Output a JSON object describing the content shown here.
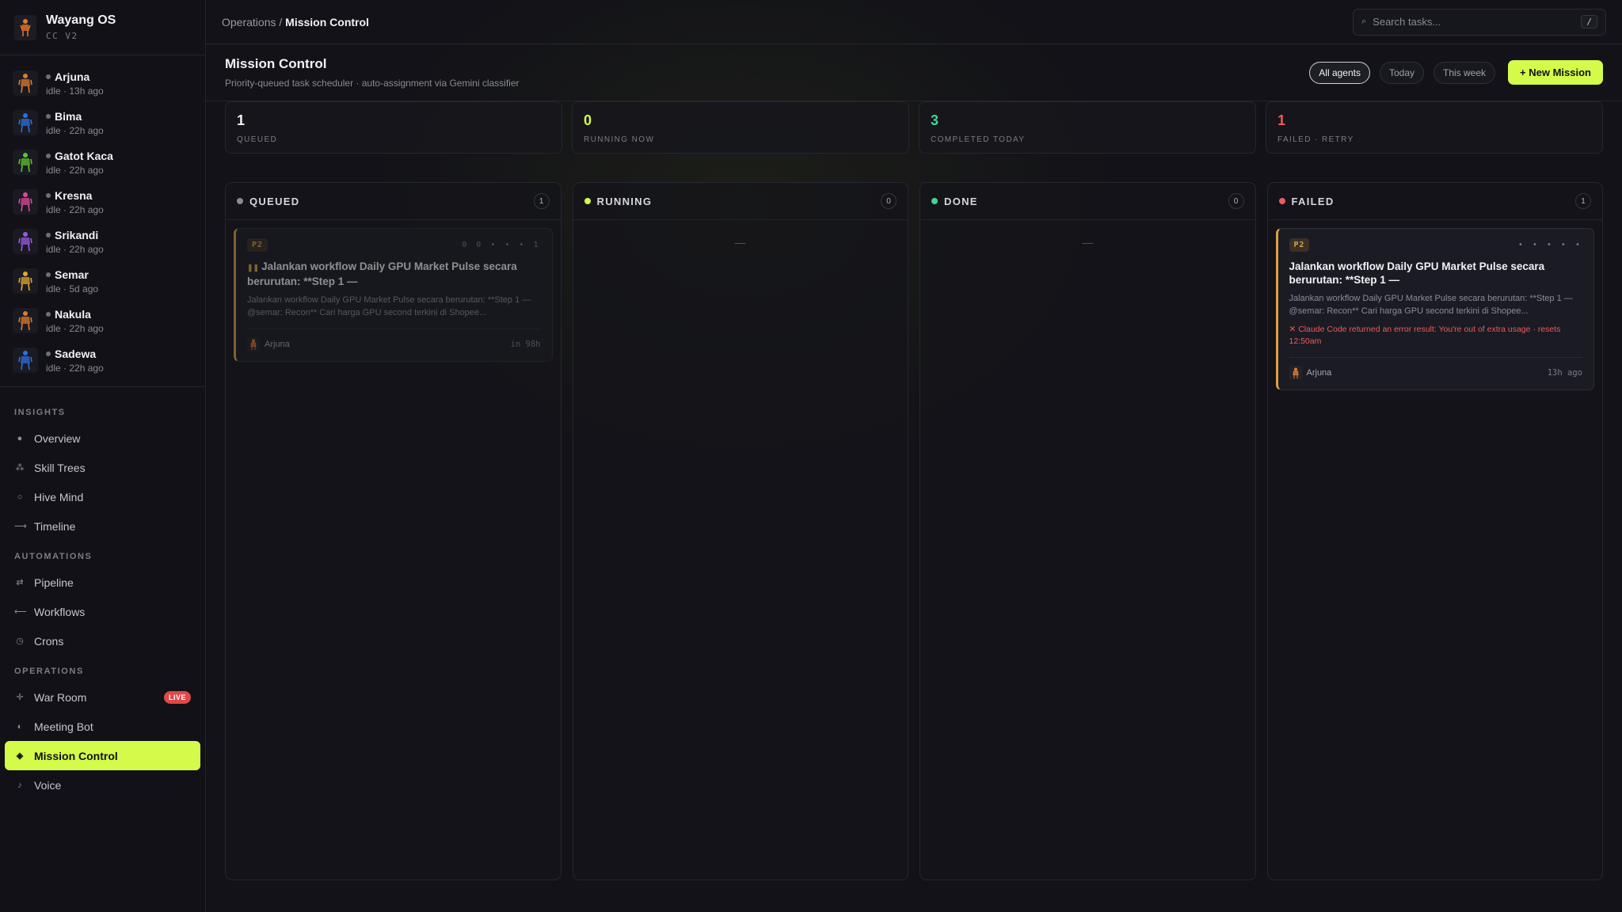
{
  "brand": {
    "name": "Wayang OS",
    "sub": "CC V2"
  },
  "agents": [
    {
      "name": "Arjuna",
      "status": "idle · 13h ago",
      "color": "#e07a2c",
      "icon": "arjuna-puppet-icon"
    },
    {
      "name": "Bima",
      "status": "idle · 22h ago",
      "color": "#2f6fe0",
      "icon": "bima-puppet-icon"
    },
    {
      "name": "Gatot Kaca",
      "status": "idle · 22h ago",
      "color": "#5fc42c",
      "icon": "gatot-kaca-puppet-icon"
    },
    {
      "name": "Kresna",
      "status": "idle · 22h ago",
      "color": "#e04a9a",
      "icon": "kresna-puppet-icon"
    },
    {
      "name": "Srikandi",
      "status": "idle · 22h ago",
      "color": "#9a5ae0",
      "icon": "srikandi-puppet-icon"
    },
    {
      "name": "Semar",
      "status": "idle · 5d ago",
      "color": "#e0a82c",
      "icon": "semar-puppet-icon"
    },
    {
      "name": "Nakula",
      "status": "idle · 22h ago",
      "color": "#e07a2c",
      "icon": "nakula-puppet-icon"
    },
    {
      "name": "Sadewa",
      "status": "idle · 22h ago",
      "color": "#2f6fe0",
      "icon": "sadewa-puppet-icon"
    }
  ],
  "nav": {
    "insights": {
      "title": "INSIGHTS",
      "items": [
        {
          "label": "Overview",
          "glyph": "●"
        },
        {
          "label": "Skill Trees",
          "glyph": "⁂"
        },
        {
          "label": "Hive Mind",
          "glyph": "○"
        },
        {
          "label": "Timeline",
          "glyph": "⟶"
        }
      ]
    },
    "automations": {
      "title": "AUTOMATIONS",
      "items": [
        {
          "label": "Pipeline",
          "glyph": "⇄"
        },
        {
          "label": "Workflows",
          "glyph": "⟵"
        },
        {
          "label": "Crons",
          "glyph": "◷"
        }
      ]
    },
    "operations": {
      "title": "OPERATIONS",
      "items": [
        {
          "label": "War Room",
          "glyph": "✛",
          "badge": "LIVE"
        },
        {
          "label": "Meeting Bot",
          "glyph": "◐"
        },
        {
          "label": "Mission Control",
          "glyph": "◈"
        },
        {
          "label": "Voice",
          "glyph": "♪"
        }
      ]
    }
  },
  "topbar": {
    "crumb_parent": "Operations /",
    "crumb_current": "Mission Control",
    "search_placeholder": "Search tasks...",
    "search_shortcut": "/"
  },
  "header": {
    "title": "Mission Control",
    "subtitle": "Priority-queued task scheduler · auto-assignment via Gemini classifier",
    "filters": [
      "All agents",
      "Today",
      "This week"
    ],
    "new_button": "+ New Mission"
  },
  "stats": [
    {
      "value": "1",
      "label": "QUEUED",
      "color": "#f2f2f5"
    },
    {
      "value": "0",
      "label": "RUNNING NOW",
      "color": "#d4fb4a"
    },
    {
      "value": "3",
      "label": "COMPLETED TODAY",
      "color": "#3ed598"
    },
    {
      "value": "1",
      "label": "FAILED · RETRY",
      "color": "#ef5a5a"
    }
  ],
  "columns": {
    "queued": {
      "title": "QUEUED",
      "count": "1",
      "dot": "#8a8a94",
      "card": {
        "priority": "P2",
        "meta": "0 0 • • • 1",
        "title": "Jalankan workflow Daily GPU Market Pulse secara berurutan: **Step 1 —",
        "desc": "Jalankan workflow Daily GPU Market Pulse secara berurutan: **Step 1 — @semar: Recon** Cari harga GPU second terkini di Shopee...",
        "agent": "Arjuna",
        "time": "in 98h"
      }
    },
    "running": {
      "title": "RUNNING",
      "count": "0",
      "dot": "#d4fb4a",
      "empty": "—"
    },
    "done": {
      "title": "DONE",
      "count": "0",
      "dot": "#3ed598",
      "empty": "—"
    },
    "failed": {
      "title": "FAILED",
      "count": "1",
      "dot": "#ef5a5a",
      "card": {
        "priority": "P2",
        "meta": "• • • • •",
        "title": "Jalankan workflow Daily GPU Market Pulse secara berurutan: **Step 1 —",
        "desc": "Jalankan workflow Daily GPU Market Pulse secara berurutan: **Step 1 — @semar: Recon** Cari harga GPU second terkini di Shopee...",
        "error": "✕ Claude Code returned an error result: You're out of extra usage · resets 12:50am",
        "agent": "Arjuna",
        "time": "13h ago"
      }
    }
  },
  "colors": {
    "accent": "#d4fb4a",
    "priority": "#d9a240",
    "danger": "#ef5a5a",
    "success": "#3ed598"
  }
}
